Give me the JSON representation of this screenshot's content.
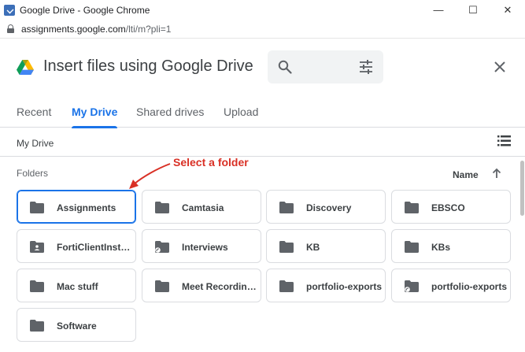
{
  "window": {
    "title": "Google Drive - Google Chrome",
    "minimize": "—",
    "maximize": "☐",
    "close": "✕"
  },
  "address": {
    "host": "assignments.google.com",
    "path": "/lti/m?pli=1"
  },
  "picker": {
    "title": "Insert files using Google Drive",
    "search_placeholder": "",
    "icons": {
      "logo": "google-drive-logo",
      "search": "search-icon",
      "filter": "tune-icon",
      "close": "close-icon"
    }
  },
  "tabs": [
    {
      "label": "Recent",
      "active": false
    },
    {
      "label": "My Drive",
      "active": true
    },
    {
      "label": "Shared drives",
      "active": false
    },
    {
      "label": "Upload",
      "active": false
    }
  ],
  "breadcrumb": "My Drive",
  "folders_section": {
    "label": "Folders",
    "sort_label": "Name",
    "annotation": "Select a folder"
  },
  "folders": [
    {
      "name": "Assignments",
      "icon": "folder",
      "selected": true
    },
    {
      "name": "Camtasia",
      "icon": "folder",
      "selected": false
    },
    {
      "name": "Discovery",
      "icon": "folder",
      "selected": false
    },
    {
      "name": "EBSCO",
      "icon": "folder",
      "selected": false
    },
    {
      "name": "FortiClientInstallers",
      "icon": "shared-folder",
      "selected": false
    },
    {
      "name": "Interviews",
      "icon": "shortcut-folder",
      "selected": false
    },
    {
      "name": "KB",
      "icon": "folder",
      "selected": false
    },
    {
      "name": "KBs",
      "icon": "folder",
      "selected": false
    },
    {
      "name": "Mac stuff",
      "icon": "folder",
      "selected": false
    },
    {
      "name": "Meet Recordings",
      "icon": "folder",
      "selected": false
    },
    {
      "name": "portfolio-exports",
      "icon": "folder",
      "selected": false
    },
    {
      "name": "portfolio-exports",
      "icon": "shortcut-folder",
      "selected": false
    },
    {
      "name": "Software",
      "icon": "folder",
      "selected": false
    }
  ],
  "colors": {
    "accent": "#1a73e8",
    "annotation": "#d93025",
    "folder_icon": "#5f6368"
  }
}
